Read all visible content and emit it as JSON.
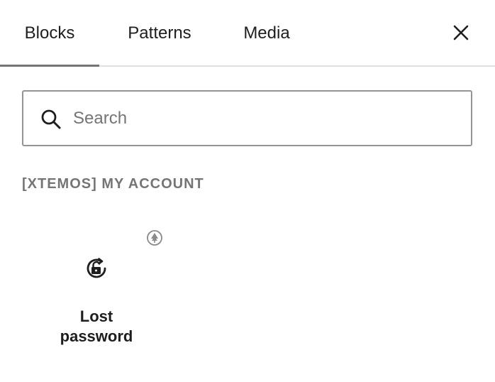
{
  "tabs": [
    {
      "label": "Blocks",
      "active": true
    },
    {
      "label": "Patterns",
      "active": false
    },
    {
      "label": "Media",
      "active": false
    }
  ],
  "search": {
    "placeholder": "Search",
    "value": ""
  },
  "category": {
    "title": "[XTEMOS] MY ACCOUNT"
  },
  "blocks": [
    {
      "label": "Lost password",
      "icon": "unlock-refresh-icon",
      "badge_icon": "tree-badge-icon"
    }
  ],
  "colors": {
    "text": "#1e1e1e",
    "muted": "#757575",
    "border": "#949494",
    "divider": "#e0e0e0"
  }
}
